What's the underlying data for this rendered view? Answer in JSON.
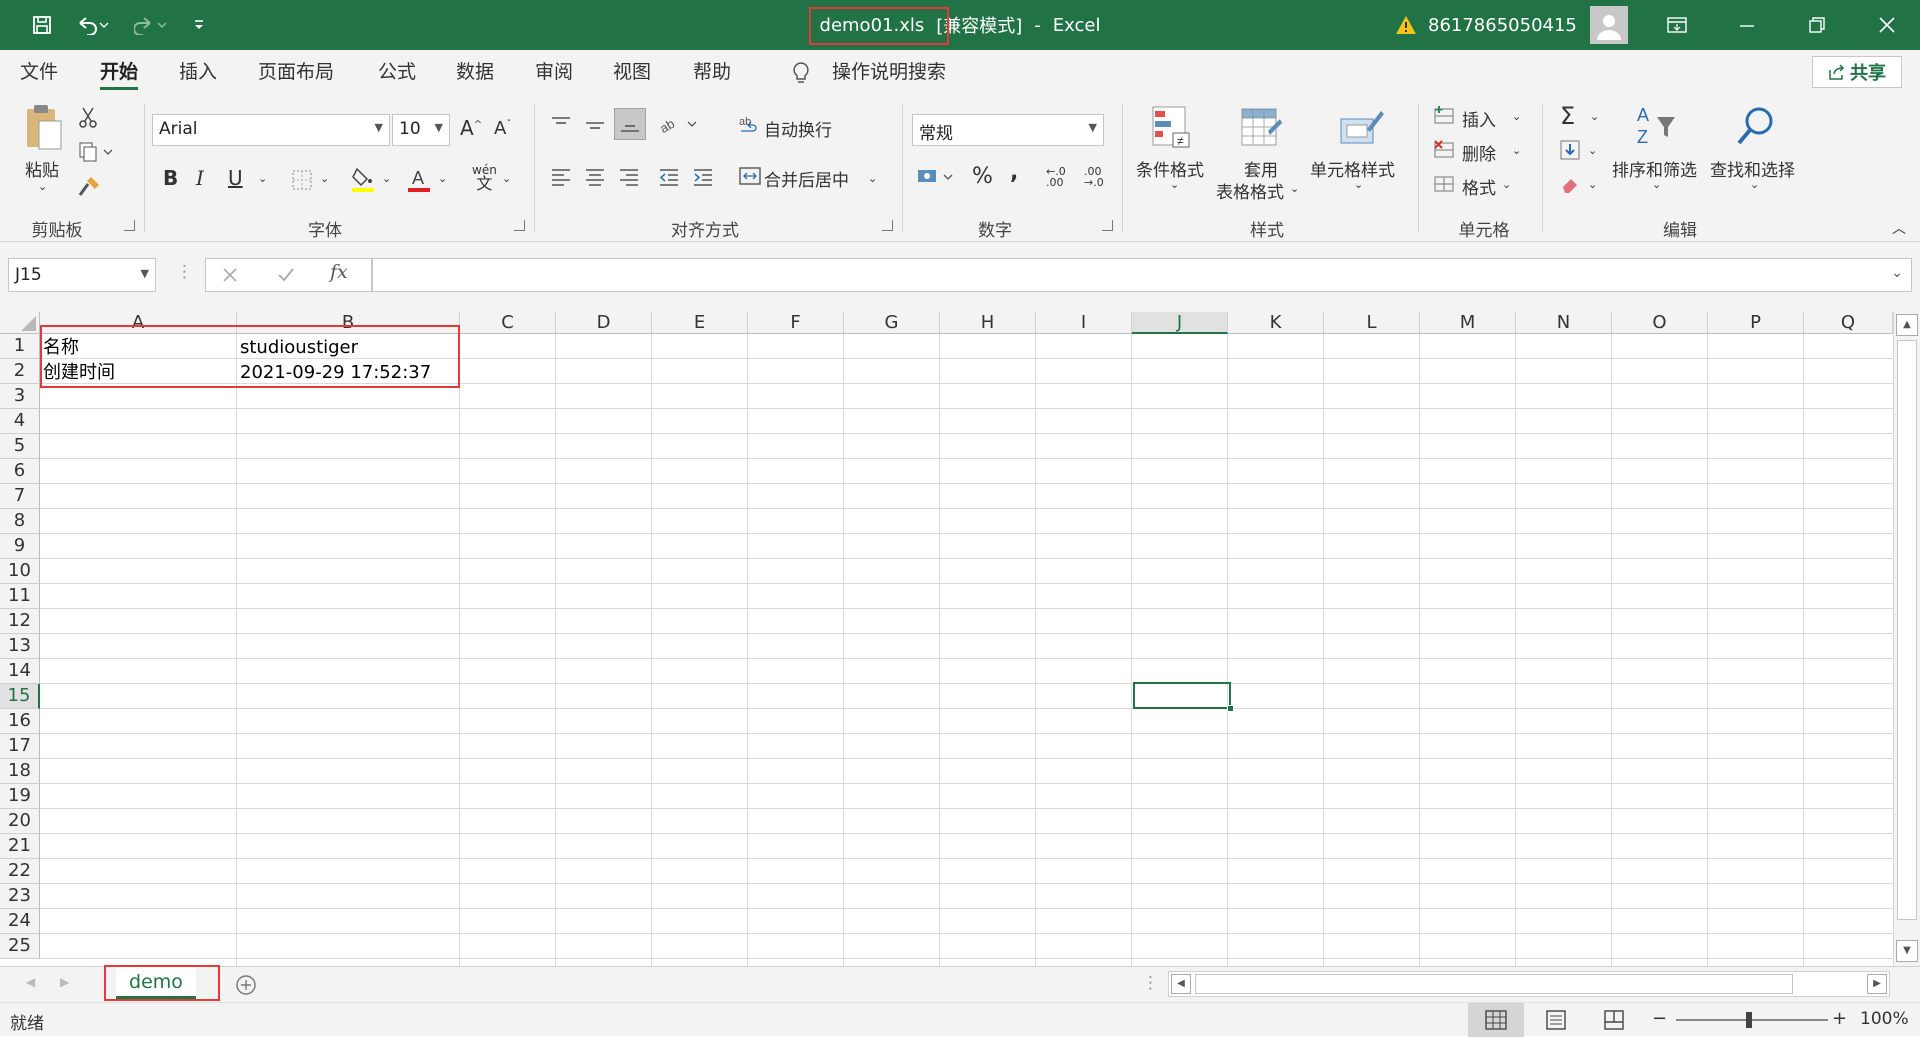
{
  "window": {
    "filename": "demo01.xls",
    "mode": "[兼容模式]",
    "separator": "-",
    "app": "Excel",
    "user": "8617865050415",
    "accent": "#217346"
  },
  "quick_access": {
    "save": "save-icon",
    "undo": "undo-icon",
    "redo": "redo-icon",
    "customize": "customize-icon"
  },
  "tabs": [
    "文件",
    "开始",
    "插入",
    "页面布局",
    "公式",
    "数据",
    "审阅",
    "视图",
    "帮助"
  ],
  "active_tab": "开始",
  "tell_me": "操作说明搜索",
  "share": "共享",
  "ribbon": {
    "clipboard": {
      "label": "剪贴板",
      "paste": "粘贴"
    },
    "font": {
      "label": "字体",
      "name": "Arial",
      "size": "10"
    },
    "alignment": {
      "label": "对齐方式",
      "wrap": "自动换行",
      "merge": "合并后居中"
    },
    "number": {
      "label": "数字",
      "format": "常规"
    },
    "styles": {
      "label": "样式",
      "conditional": "条件格式",
      "table_l1": "套用",
      "table_l2": "表格格式",
      "cell_styles": "单元格样式"
    },
    "cells": {
      "label": "单元格",
      "insert": "插入",
      "delete": "删除",
      "format": "格式"
    },
    "editing": {
      "label": "编辑",
      "sort": "排序和筛选",
      "find": "查找和选择"
    }
  },
  "formula_bar": {
    "name_box": "J15",
    "formula": ""
  },
  "columns": [
    "A",
    "B",
    "C",
    "D",
    "E",
    "F",
    "G",
    "H",
    "I",
    "J",
    "K",
    "L",
    "M",
    "N",
    "O",
    "P",
    "Q"
  ],
  "rows": [
    "1",
    "2",
    "3",
    "4",
    "5",
    "6",
    "7",
    "8",
    "9",
    "10",
    "11",
    "12",
    "13",
    "14",
    "15",
    "16",
    "17",
    "18",
    "19",
    "20",
    "21",
    "22",
    "23",
    "24",
    "25"
  ],
  "selected_cell": {
    "column": "J",
    "row": "15"
  },
  "cells": {
    "A1": "名称",
    "B1": "studioustiger",
    "A2": "创建时间",
    "B2": "2021-09-29 17:52:37"
  },
  "sheets": [
    "demo"
  ],
  "active_sheet": "demo",
  "status": {
    "text": "就绪",
    "zoom": "100%"
  }
}
